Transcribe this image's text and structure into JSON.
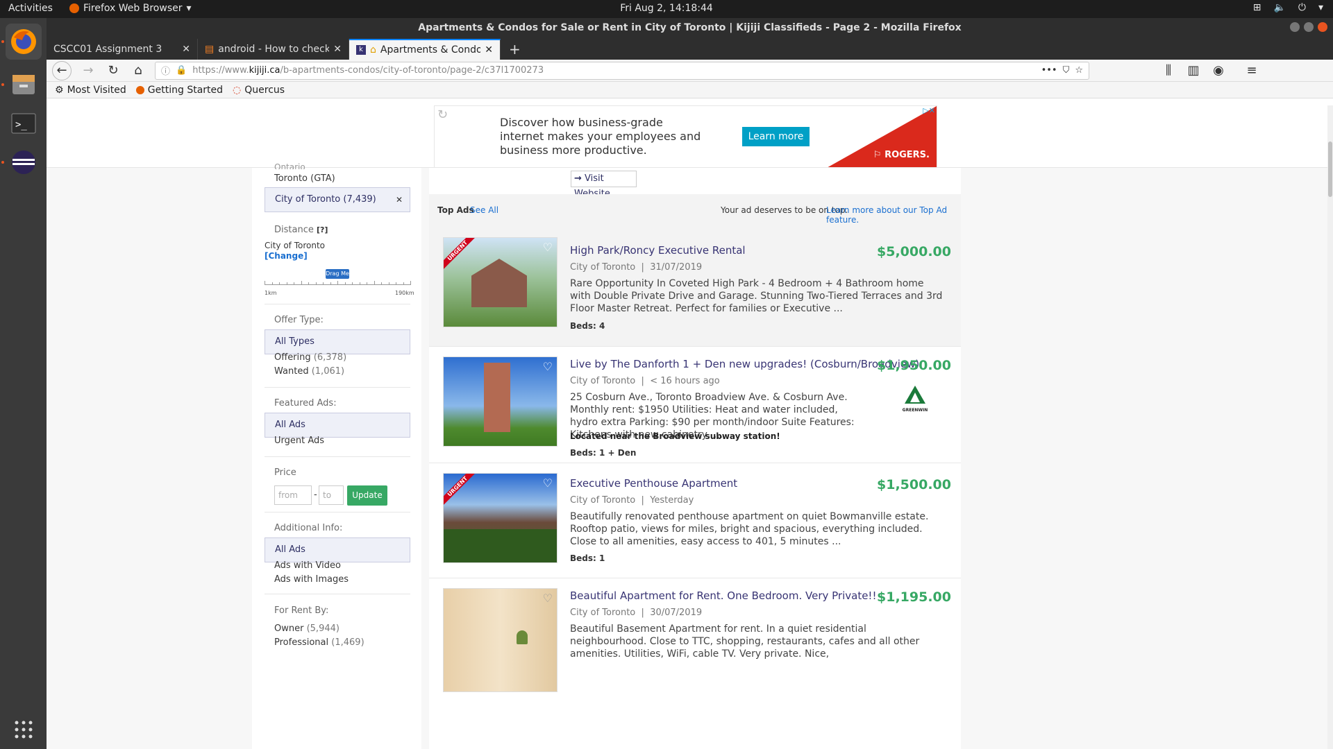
{
  "topbar": {
    "activities": "Activities",
    "app_menu": "Firefox Web Browser",
    "clock": "Fri Aug  2, 14:18:44"
  },
  "window": {
    "title": "Apartments & Condos for Sale or Rent in City of Toronto | Kijiji Classifieds - Page 2 - Mozilla Firefox"
  },
  "tabs": [
    {
      "label": "CSCC01 Assignment 3"
    },
    {
      "label": "android - How to check d"
    },
    {
      "label": "Apartments & Condos"
    }
  ],
  "navbar": {
    "url_prefix": "https://www.",
    "url_domain": "kijiji.ca",
    "url_path": "/b-apartments-condos/city-of-toronto/page-2/c37l1700273"
  },
  "bookmarks": [
    {
      "label": "Most Visited"
    },
    {
      "label": "Getting Started"
    },
    {
      "label": "Quercus"
    }
  ],
  "ad": {
    "text": "Discover how business-grade internet makes your employees and business more productive.",
    "button": "Learn more",
    "brand": "ROGERS."
  },
  "sidebar": {
    "location_partial": "Ontario",
    "toronto_gta": "Toronto (GTA)",
    "selected_location": "City of Toronto (7,439)",
    "distance_label": "Distance",
    "distance_help": "[?]",
    "distance_city": "City of Toronto",
    "distance_change": "[Change]",
    "slider_handle": "Drag Me",
    "slider_min": "1km",
    "slider_max": "190km",
    "slider_level_percent": 50,
    "offer_type_label": "Offer Type:",
    "offer_all": "All Types",
    "offering": "Offering",
    "offering_count": "(6,378)",
    "wanted": "Wanted",
    "wanted_count": "(1,061)",
    "featured_label": "Featured Ads:",
    "featured_all": "All Ads",
    "urgent_ads": "Urgent Ads",
    "price_label": "Price",
    "price_from": "from",
    "price_dash": "-",
    "price_to": "to",
    "update": "Update",
    "additional_label": "Additional Info:",
    "additional_all": "All Ads",
    "ads_with_video": "Ads with Video",
    "ads_with_images": "Ads with Images",
    "rent_by_label": "For Rent By:",
    "owner": "Owner",
    "owner_count": "(5,944)",
    "professional": "Professional",
    "professional_count": "(1,469)"
  },
  "main": {
    "visit_website": "Visit Website",
    "top_ads": "Top Ads",
    "see_all": "See All",
    "promo_text": "Your ad deserves to be on top.",
    "promo_link": "Learn more about our Top Ad feature."
  },
  "listings": [
    {
      "title": "High Park/Roncy Executive Rental",
      "location": "City of Toronto",
      "date": "31/07/2019",
      "description": "Rare Opportunity In Coveted High Park - 4 Bedroom + 4 Bathroom home with Double Private Drive and Garage. Stunning Two-Tiered Terraces and 3rd Floor Master Retreat. Perfect for families or Executive ...",
      "beds": "Beds: 4",
      "price": "$5,000.00",
      "urgent": "URGENT"
    },
    {
      "title": "Live by The Danforth 1 + Den new upgrades! (Cosburn/Broadview)",
      "location": "City of Toronto",
      "date": "< 16 hours ago",
      "description": "25 Cosburn Ave., Toronto Broadview Ave. & Cosburn Ave. Monthly rent: $1950 Utilities: Heat and water included, hydro extra Parking: $90 per month/indoor Suite Features: Kitchens with new cabinetry, ...",
      "extra": "Located near the Broadview subway station!",
      "beds": "Beds: 1 + Den",
      "price": "$1,950.00",
      "logo_text": "GREENWIN"
    },
    {
      "title": "Executive Penthouse Apartment",
      "location": "City of Toronto",
      "date": "Yesterday",
      "description": "Beautifully renovated penthouse apartment on quiet Bowmanville estate. Rooftop patio, views for miles, bright and spacious, everything included. Close to all amenities, easy access to 401, 5 minutes ...",
      "beds": "Beds: 1",
      "price": "$1,500.00",
      "urgent": "URGENT"
    },
    {
      "title": "Beautiful Apartment for Rent. One Bedroom. Very Private!!",
      "location": "City of Toronto",
      "date": "30/07/2019",
      "description": "Beautiful Basement Apartment for rent. In a quiet residential neighbourhood. Close to TTC, shopping, restaurants, cafes and all other amenities. Utilities, WiFi, cable TV. Very private. Nice,",
      "price": "$1,195.00"
    }
  ]
}
